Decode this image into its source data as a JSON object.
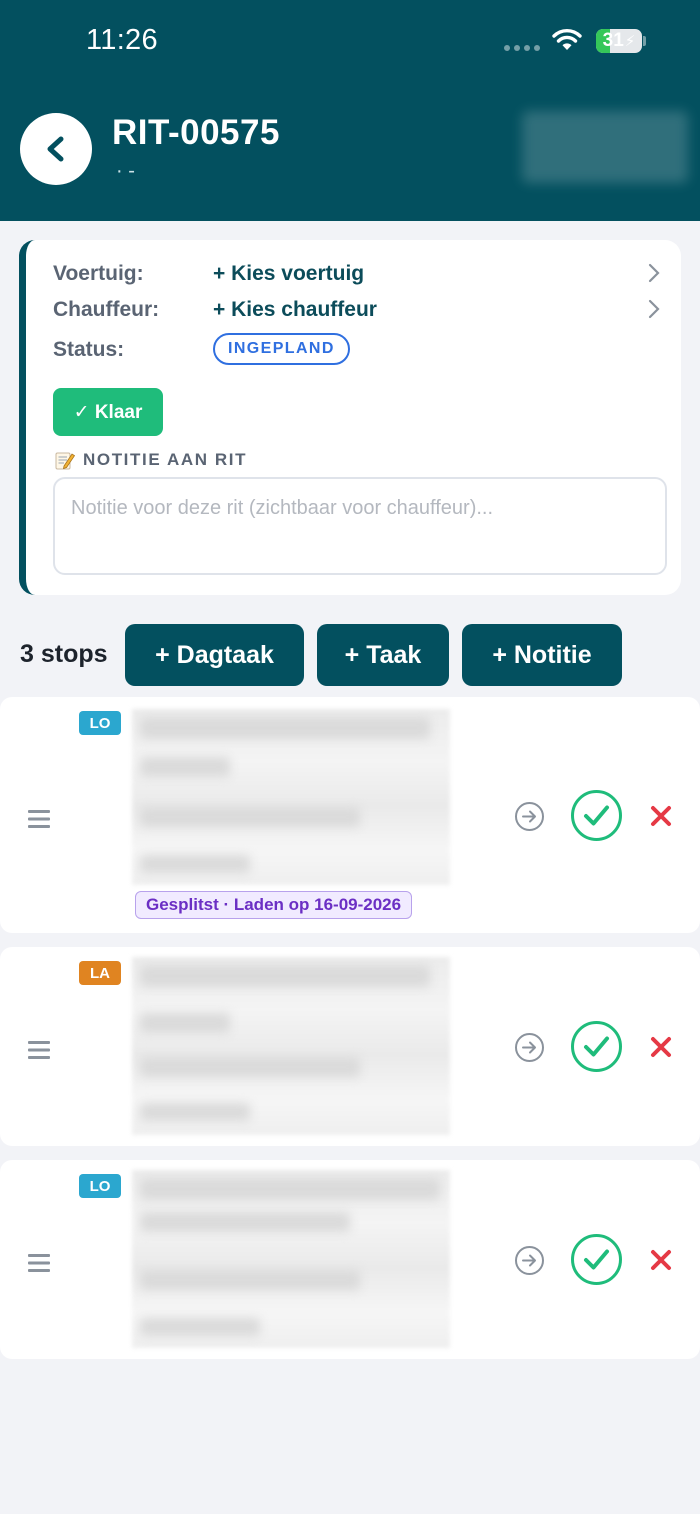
{
  "status_bar": {
    "time": "11:26",
    "battery_level": "31",
    "battery_percent": 31
  },
  "header": {
    "title": "RIT-00575",
    "subtitle": "· -"
  },
  "info": {
    "vehicle_label": "Voertuig:",
    "vehicle_value": "+ Kies voertuig",
    "driver_label": "Chauffeur:",
    "driver_value": "+ Kies chauffeur",
    "status_label": "Status:",
    "status_value": "INGEPLAND",
    "done_button": "✓ Klaar",
    "note_heading": "NOTITIE AAN RIT",
    "note_placeholder": "Notitie voor deze rit (zichtbaar voor chauffeur)..."
  },
  "stops_header": {
    "count_label": "3 stops",
    "add_daytask": "+ Dagtaak",
    "add_task": "+ Taak",
    "add_note": "+ Notitie"
  },
  "stops": [
    {
      "type": "LO",
      "tag": "Gesplitst · Laden op 16-09-2026"
    },
    {
      "type": "LA"
    },
    {
      "type": "LO"
    }
  ],
  "colors": {
    "header_bg": "#03505f",
    "primary": "#03505f",
    "success": "#1fbc7b",
    "status_blue": "#2f6fe0",
    "lo_badge": "#2ba7cf",
    "la_badge": "#e08421",
    "danger": "#e53945",
    "split_purple": "#6b2fc4"
  },
  "icons": [
    "back-chevron-icon",
    "chevron-right-icon",
    "memo-icon",
    "drag-handle-icon",
    "arrow-right-circle-icon",
    "check-circle-icon",
    "close-x-icon",
    "wifi-icon"
  ]
}
